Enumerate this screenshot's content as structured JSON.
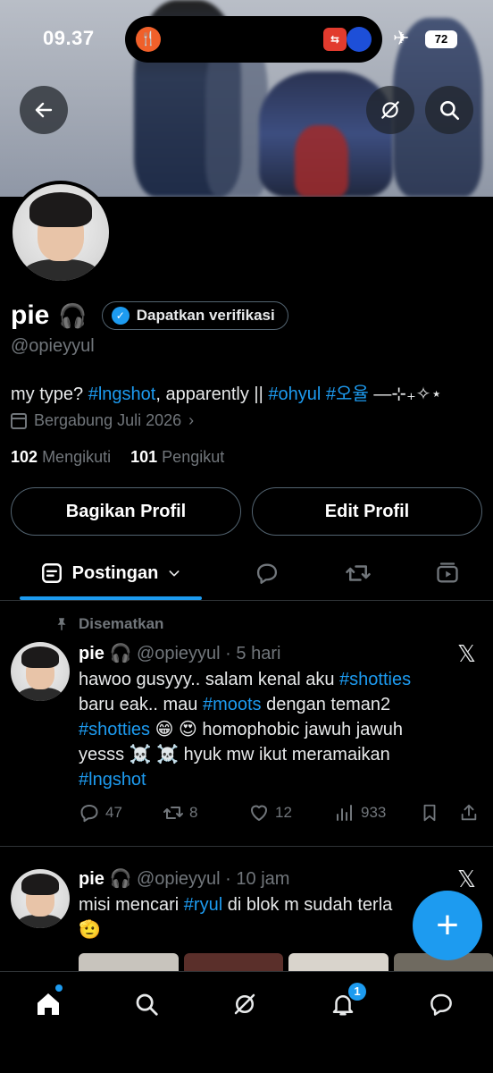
{
  "status_bar": {
    "time": "09.37",
    "battery": "72"
  },
  "profile": {
    "name": "pie",
    "name_emoji": "🎧",
    "verify_label": "Dapatkan verifikasi",
    "handle": "@opieyyul",
    "bio_parts": {
      "t1": "my type? ",
      "h1": "#lngshot",
      "t2": ", apparently || ",
      "h2": "#ohyul",
      "t3": " ",
      "h3": "#오율",
      "t4": " —⊹₊✧⋆"
    },
    "joined": "Bergabung Juli 2026",
    "following_count": "102",
    "following_label": "Mengikuti",
    "followers_count": "101",
    "followers_label": "Pengikut",
    "share_button": "Bagikan Profil",
    "edit_button": "Edit Profil"
  },
  "tabs": {
    "active_label": "Postingan"
  },
  "pinned_label": "Disematkan",
  "posts": [
    {
      "name": "pie",
      "emoji": "🎧",
      "handle": "@opieyyul",
      "time": "5 hari",
      "l1a": "hawoo gusyyy.. salam kenal aku ",
      "l1b": "#shotties",
      "l2a": "baru eak.. mau ",
      "l2b": "#moots",
      "l2c": " dengan teman2",
      "l3a": "#shotties",
      "l3b": " 😁 😍 homophobic jawuh jawuh",
      "l4": "yesss ☠️ ☠️ hyuk mw ikut meramaikan",
      "l5": "#lngshot",
      "replies": "47",
      "reposts": "8",
      "likes": "12",
      "views": "933"
    },
    {
      "name": "pie",
      "emoji": "🎧",
      "handle": "@opieyyul",
      "time": "10 jam",
      "l1a": "misi mencari ",
      "l1b": "#ryul",
      "l1c": " di blok m sudah terla",
      "l2": "🫡"
    }
  ],
  "nav": {
    "notif_badge": "1"
  },
  "colors": {
    "accent": "#1d9bf0",
    "background": "#000000",
    "muted": "#71767b"
  }
}
